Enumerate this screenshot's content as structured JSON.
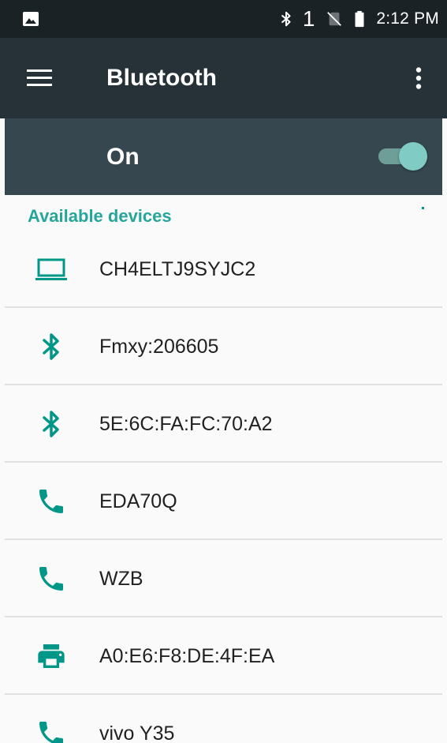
{
  "status_bar": {
    "left_icon": "image-icon",
    "right_icons": [
      "bluetooth-icon",
      "sim-missing-icon",
      "battery-icon"
    ],
    "notification_count": "1",
    "time": "2:12 PM"
  },
  "app_bar": {
    "title": "Bluetooth",
    "nav_icon": "menu-icon",
    "overflow_icon": "more-vert-icon"
  },
  "switch_bar": {
    "label": "On",
    "state": "on"
  },
  "section": {
    "header": "Available devices"
  },
  "devices": [
    {
      "name": "CH4ELTJ9SYJC2",
      "icon": "laptop-icon"
    },
    {
      "name": "Fmxy:206605",
      "icon": "bluetooth-icon"
    },
    {
      "name": "5E:6C:FA:FC:70:A2",
      "icon": "bluetooth-icon"
    },
    {
      "name": "EDA70Q",
      "icon": "phone-icon"
    },
    {
      "name": "WZB",
      "icon": "phone-icon"
    },
    {
      "name": "A0:E6:F8:DE:4F:EA",
      "icon": "printer-icon"
    },
    {
      "name": "vivo Y35",
      "icon": "phone-icon"
    }
  ],
  "colors": {
    "status_bar": "#1b2226",
    "app_bar": "#263238",
    "switch_bar": "#37474f",
    "accent": "#009688",
    "section_header": "#26a69a",
    "toggle_thumb": "#80cbc4",
    "list_background": "#fafafa",
    "divider": "#e0e0e0"
  }
}
